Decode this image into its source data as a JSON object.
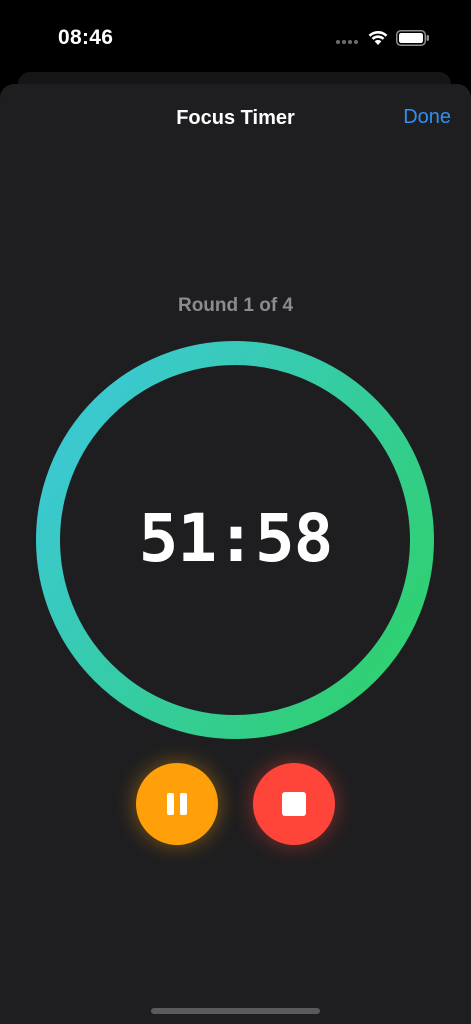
{
  "status_bar": {
    "time": "08:46",
    "icons": [
      "signal-dots-icon",
      "wifi-icon",
      "battery-icon"
    ]
  },
  "nav": {
    "title": "Focus Timer",
    "done_label": "Done"
  },
  "timer": {
    "round_label": "Round 1 of 4",
    "time_remaining": "51:58",
    "progress_fraction": 1.0
  },
  "controls": {
    "pause_icon": "pause-icon",
    "stop_icon": "stop-icon"
  },
  "colors": {
    "background": "#1e1e20",
    "accent_blue": "#2f8ff5",
    "ring_gradient_start": "#2fd06e",
    "ring_gradient_end": "#3cc8d8",
    "pause_button": "#ff9f0a",
    "stop_button": "#ff453a",
    "secondary_text": "#8b8b90"
  }
}
